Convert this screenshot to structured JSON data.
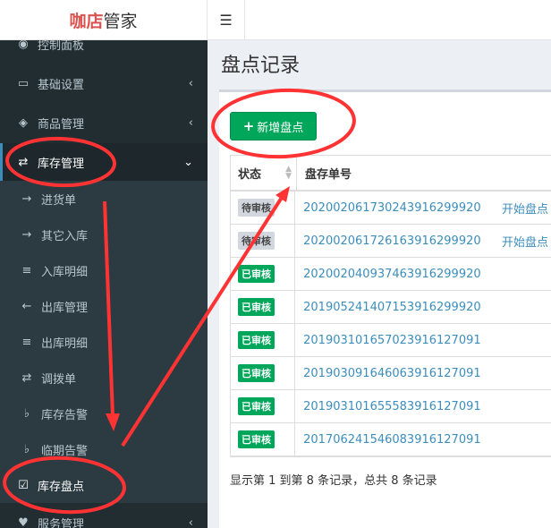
{
  "brand": {
    "part1": "咖店",
    "part2": "管家"
  },
  "topbar": {
    "toggle_icon": "☰"
  },
  "sidebar": {
    "items": [
      {
        "label": "控制面板",
        "icon": "dashboard-icon"
      },
      {
        "label": "基础设置",
        "icon": "laptop-icon"
      },
      {
        "label": "商品管理",
        "icon": "cubes-icon"
      },
      {
        "label": "库存管理",
        "icon": "exchange-icon"
      },
      {
        "label": "进货单",
        "icon": "arrow-right-icon"
      },
      {
        "label": "其它入库",
        "icon": "arrow-right-icon"
      },
      {
        "label": "入库明细",
        "icon": "list-icon"
      },
      {
        "label": "出库管理",
        "icon": "arrow-left-icon"
      },
      {
        "label": "出库明细",
        "icon": "list-icon"
      },
      {
        "label": "调拨单",
        "icon": "exchange-icon"
      },
      {
        "label": "库存告警",
        "icon": "bell-icon"
      },
      {
        "label": "临期告警",
        "icon": "bell-icon"
      },
      {
        "label": "库存盘点",
        "icon": "check-square-icon"
      },
      {
        "label": "服务管理",
        "icon": "heart-icon"
      }
    ]
  },
  "page": {
    "title": "盘点记录"
  },
  "toolbar": {
    "add_label": "新增盘点"
  },
  "table": {
    "headers": {
      "status": "状态",
      "no": "盘存单号"
    },
    "rows": [
      {
        "status": "待审核",
        "no": "20200206173024391629992​0",
        "op": "开始盘点"
      },
      {
        "status": "待审核",
        "no": "202002061726163916299920",
        "op": "开始盘点"
      },
      {
        "status": "已审核",
        "no": "202002040937463916299920",
        "op": ""
      },
      {
        "status": "已审核",
        "no": "201905241407153916299920",
        "op": ""
      },
      {
        "status": "已审核",
        "no": "201903101657023916127091",
        "op": ""
      },
      {
        "status": "已审核",
        "no": "201903091646063916127091",
        "op": ""
      },
      {
        "status": "已审核",
        "no": "201903101655583916127091",
        "op": ""
      },
      {
        "status": "已审核",
        "no": "201706241546083916127091",
        "op": ""
      }
    ]
  },
  "pagination": {
    "info": "显示第 1 到第 8 条记录，总共 8 条记录"
  },
  "colors": {
    "accent_green": "#00a65a",
    "link_blue": "#3c8dbc",
    "annotation_red": "#ff3333",
    "sidebar_bg": "#222d32"
  }
}
